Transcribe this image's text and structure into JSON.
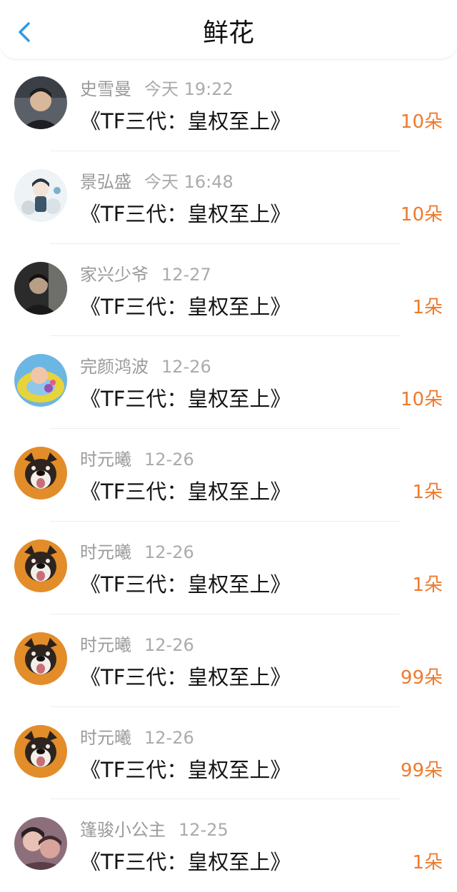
{
  "header": {
    "title": "鲜花",
    "back_icon": "chevron-left-icon",
    "accent": "#2f9be6"
  },
  "colors": {
    "count": "#ee7a2c",
    "name": "#9a9a9a",
    "book": "#151515"
  },
  "items": [
    {
      "name": "史雪曼",
      "time": "今天 19:22",
      "book": "《TF三代：皇权至上》",
      "count": "10朵",
      "avatar": "photo-portrait"
    },
    {
      "name": "景弘盛",
      "time": "今天 16:48",
      "book": "《TF三代：皇权至上》",
      "count": "10朵",
      "avatar": "cartoon-figure"
    },
    {
      "name": "家兴少爷",
      "time": "12-27",
      "book": "《TF三代：皇权至上》",
      "count": "1朵",
      "avatar": "photo-portrait-dark"
    },
    {
      "name": "完颜鸿波",
      "time": "12-26",
      "book": "《TF三代：皇权至上》",
      "count": "10朵",
      "avatar": "baby-in-float"
    },
    {
      "name": "时元曦",
      "time": "12-26",
      "book": "《TF三代：皇权至上》",
      "count": "1朵",
      "avatar": "dog-face"
    },
    {
      "name": "时元曦",
      "time": "12-26",
      "book": "《TF三代：皇权至上》",
      "count": "1朵",
      "avatar": "dog-face"
    },
    {
      "name": "时元曦",
      "time": "12-26",
      "book": "《TF三代：皇权至上》",
      "count": "99朵",
      "avatar": "dog-face"
    },
    {
      "name": "时元曦",
      "time": "12-26",
      "book": "《TF三代：皇权至上》",
      "count": "99朵",
      "avatar": "dog-face"
    },
    {
      "name": "篷骏小公主",
      "time": "12-25",
      "book": "《TF三代：皇权至上》",
      "count": "1朵",
      "avatar": "photo-couple"
    }
  ]
}
